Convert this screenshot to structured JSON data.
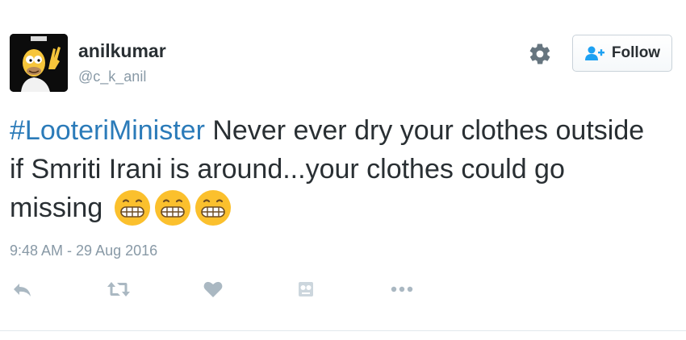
{
  "user": {
    "display_name": "anilkumar",
    "handle": "@c_k_anil"
  },
  "follow_button": {
    "label": "Follow"
  },
  "tweet": {
    "hashtag": "#LooteriMinister",
    "text": " Never ever dry your clothes outside if Smriti Irani is around...your clothes could go missing ",
    "emojis": [
      "grimacing-face",
      "grimacing-face",
      "grimacing-face"
    ],
    "timestamp": "9:48 AM - 29 Aug 2016"
  },
  "icons": {
    "settings": "gear-icon",
    "follow": "add-user-icon",
    "reply": "reply-icon",
    "retweet": "retweet-icon",
    "like": "heart-icon",
    "analytics": "analytics-icon",
    "more": "more-icon"
  },
  "colors": {
    "hashtag": "#2b7bb9",
    "muted": "#8899a6",
    "text": "#292f33",
    "follow_icon": "#1da1f2",
    "action_icon": "#aab8c2"
  }
}
